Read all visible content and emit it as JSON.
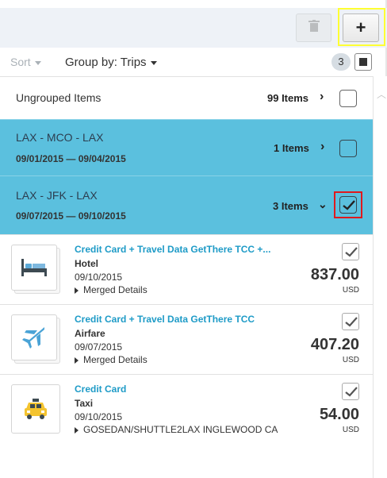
{
  "toolbar": {
    "delete_icon": "trash-icon",
    "add_label": "+",
    "highlight_color": "#ffff33"
  },
  "controls": {
    "sort_label": "Sort",
    "group_by_label": "Group by: Trips",
    "selected_count": "3"
  },
  "groups": [
    {
      "title": "Ungrouped Items",
      "dates": "",
      "items": "99 Items",
      "checked": false,
      "expanded": false
    },
    {
      "title": "LAX - MCO - LAX",
      "dates": "09/01/2015 — 09/04/2015",
      "items": "1 Items",
      "checked": false,
      "expanded": false
    },
    {
      "title": "LAX - JFK - LAX",
      "dates": "09/07/2015 — 09/10/2015",
      "items": "3 Items",
      "checked": true,
      "expanded": true
    }
  ],
  "expenses": [
    {
      "icon": "hotel-bed-icon",
      "title": "Credit Card + Travel Data GetThere TCC +...",
      "type": "Hotel",
      "date": "09/10/2015",
      "detail": "Merged Details",
      "amount": "837.00",
      "currency": "USD"
    },
    {
      "icon": "airplane-icon",
      "title": "Credit Card + Travel Data GetThere TCC",
      "type": "Airfare",
      "date": "09/07/2015",
      "detail": "Merged Details",
      "amount": "407.20",
      "currency": "USD"
    },
    {
      "icon": "taxi-icon",
      "title": "Credit Card",
      "type": "Taxi",
      "date": "09/10/2015",
      "detail": "GOSEDAN/SHUTTLE2LAX INGLEWOOD CA",
      "amount": "54.00",
      "currency": "USD"
    }
  ],
  "colors": {
    "group_bg": "#5bc0de",
    "link_blue": "#1e9bc7",
    "selection_red": "#e0191d"
  }
}
